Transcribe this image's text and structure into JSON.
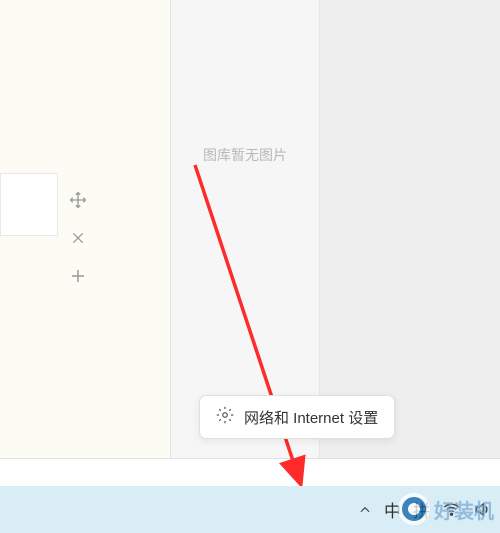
{
  "center": {
    "empty_text": "图库暂无图片"
  },
  "tooltip": {
    "label": "网络和 Internet 设置"
  },
  "taskbar": {
    "ime1": "中",
    "ime2": "拼"
  },
  "watermark": {
    "text": "好装机"
  },
  "icons": {
    "move": "move-icon",
    "close": "close-icon",
    "add": "plus-icon",
    "gear": "gear-icon",
    "chevron_up": "chevron-up-icon",
    "wifi": "wifi-icon",
    "volume": "volume-icon"
  }
}
